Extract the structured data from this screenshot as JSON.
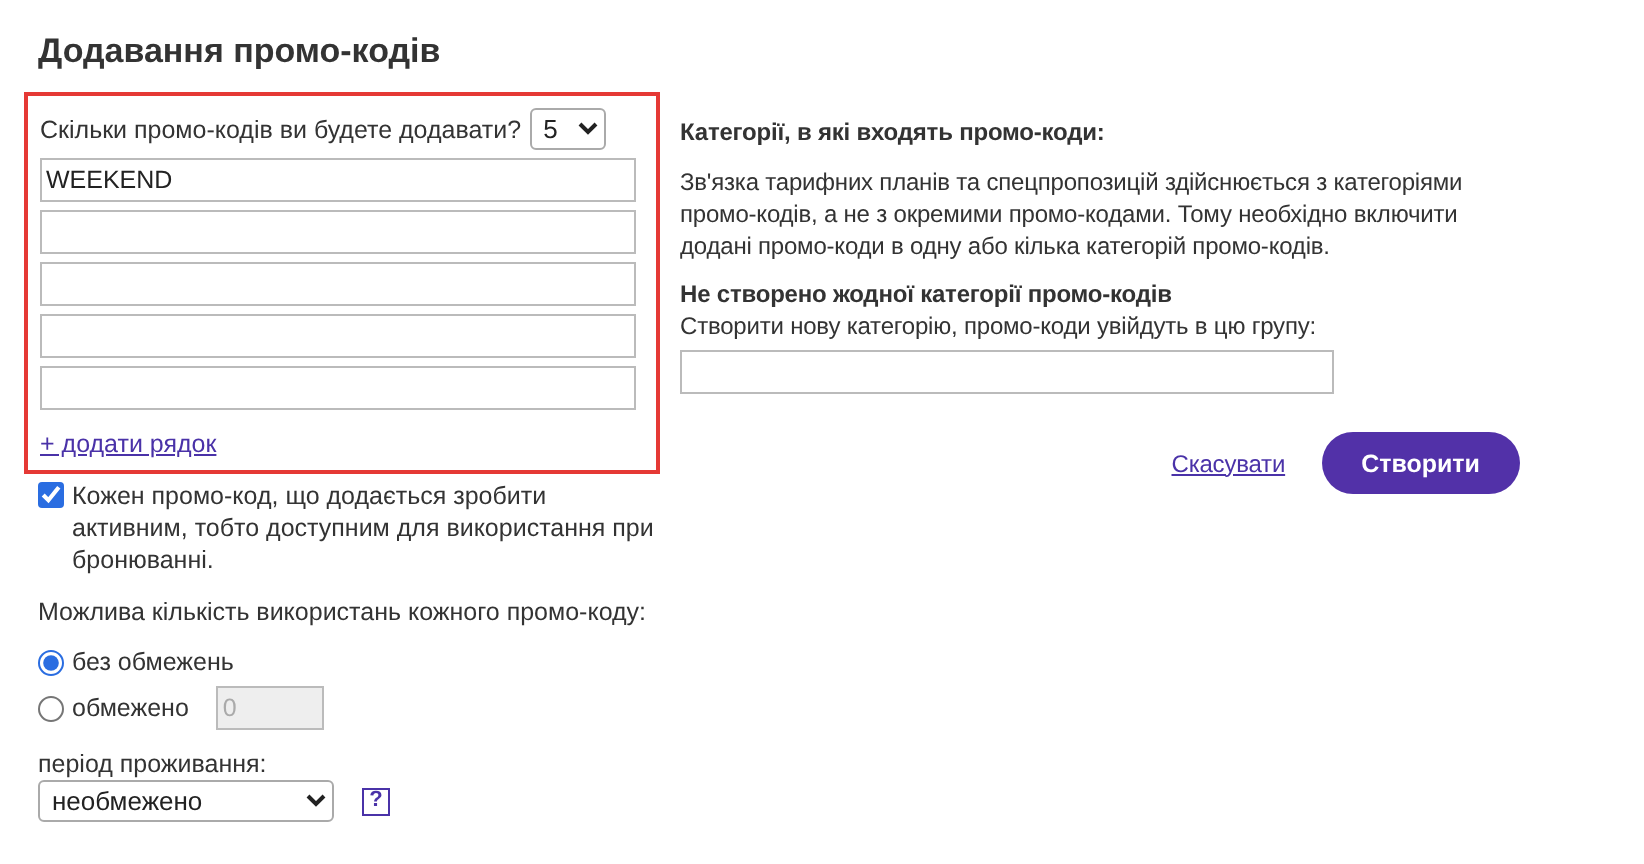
{
  "title": "Додавання промо-кодів",
  "count": {
    "label": "Скільки промо-кодів ви будете додавати?",
    "value": "5"
  },
  "codes": [
    "WEEKEND"
  ],
  "add_row": "+ додати рядок",
  "active": {
    "label": "Кожен промо-код, що додається зробити активним, тобто доступним для використання при бронюванні.",
    "checked": true
  },
  "usage": {
    "label": "Можлива кількість використань кожного промо-коду:",
    "options": [
      {
        "label": "без обмежень",
        "selected": true
      },
      {
        "label": "обмежено",
        "selected": false
      }
    ],
    "limit_value": "0"
  },
  "period": {
    "label": "період проживання:",
    "value": "необмежено",
    "help": "?"
  },
  "categories": {
    "heading": "Категорії, в які входять промо-коди:",
    "description": "Зв'язка тарифних планів та спецпропозицій здійснюється з категоріями промо-кодів, а не з окремими промо-кодами. Тому необхідно включити додані промо-коди в одну або кілька категорій промо-кодів.",
    "empty_heading": "Не створено жодної категорії промо-кодів",
    "new_label": "Створити нову категорію, промо-коди увійдуть в цю групу:"
  },
  "buttons": {
    "cancel": "Скасувати",
    "create": "Створити"
  }
}
